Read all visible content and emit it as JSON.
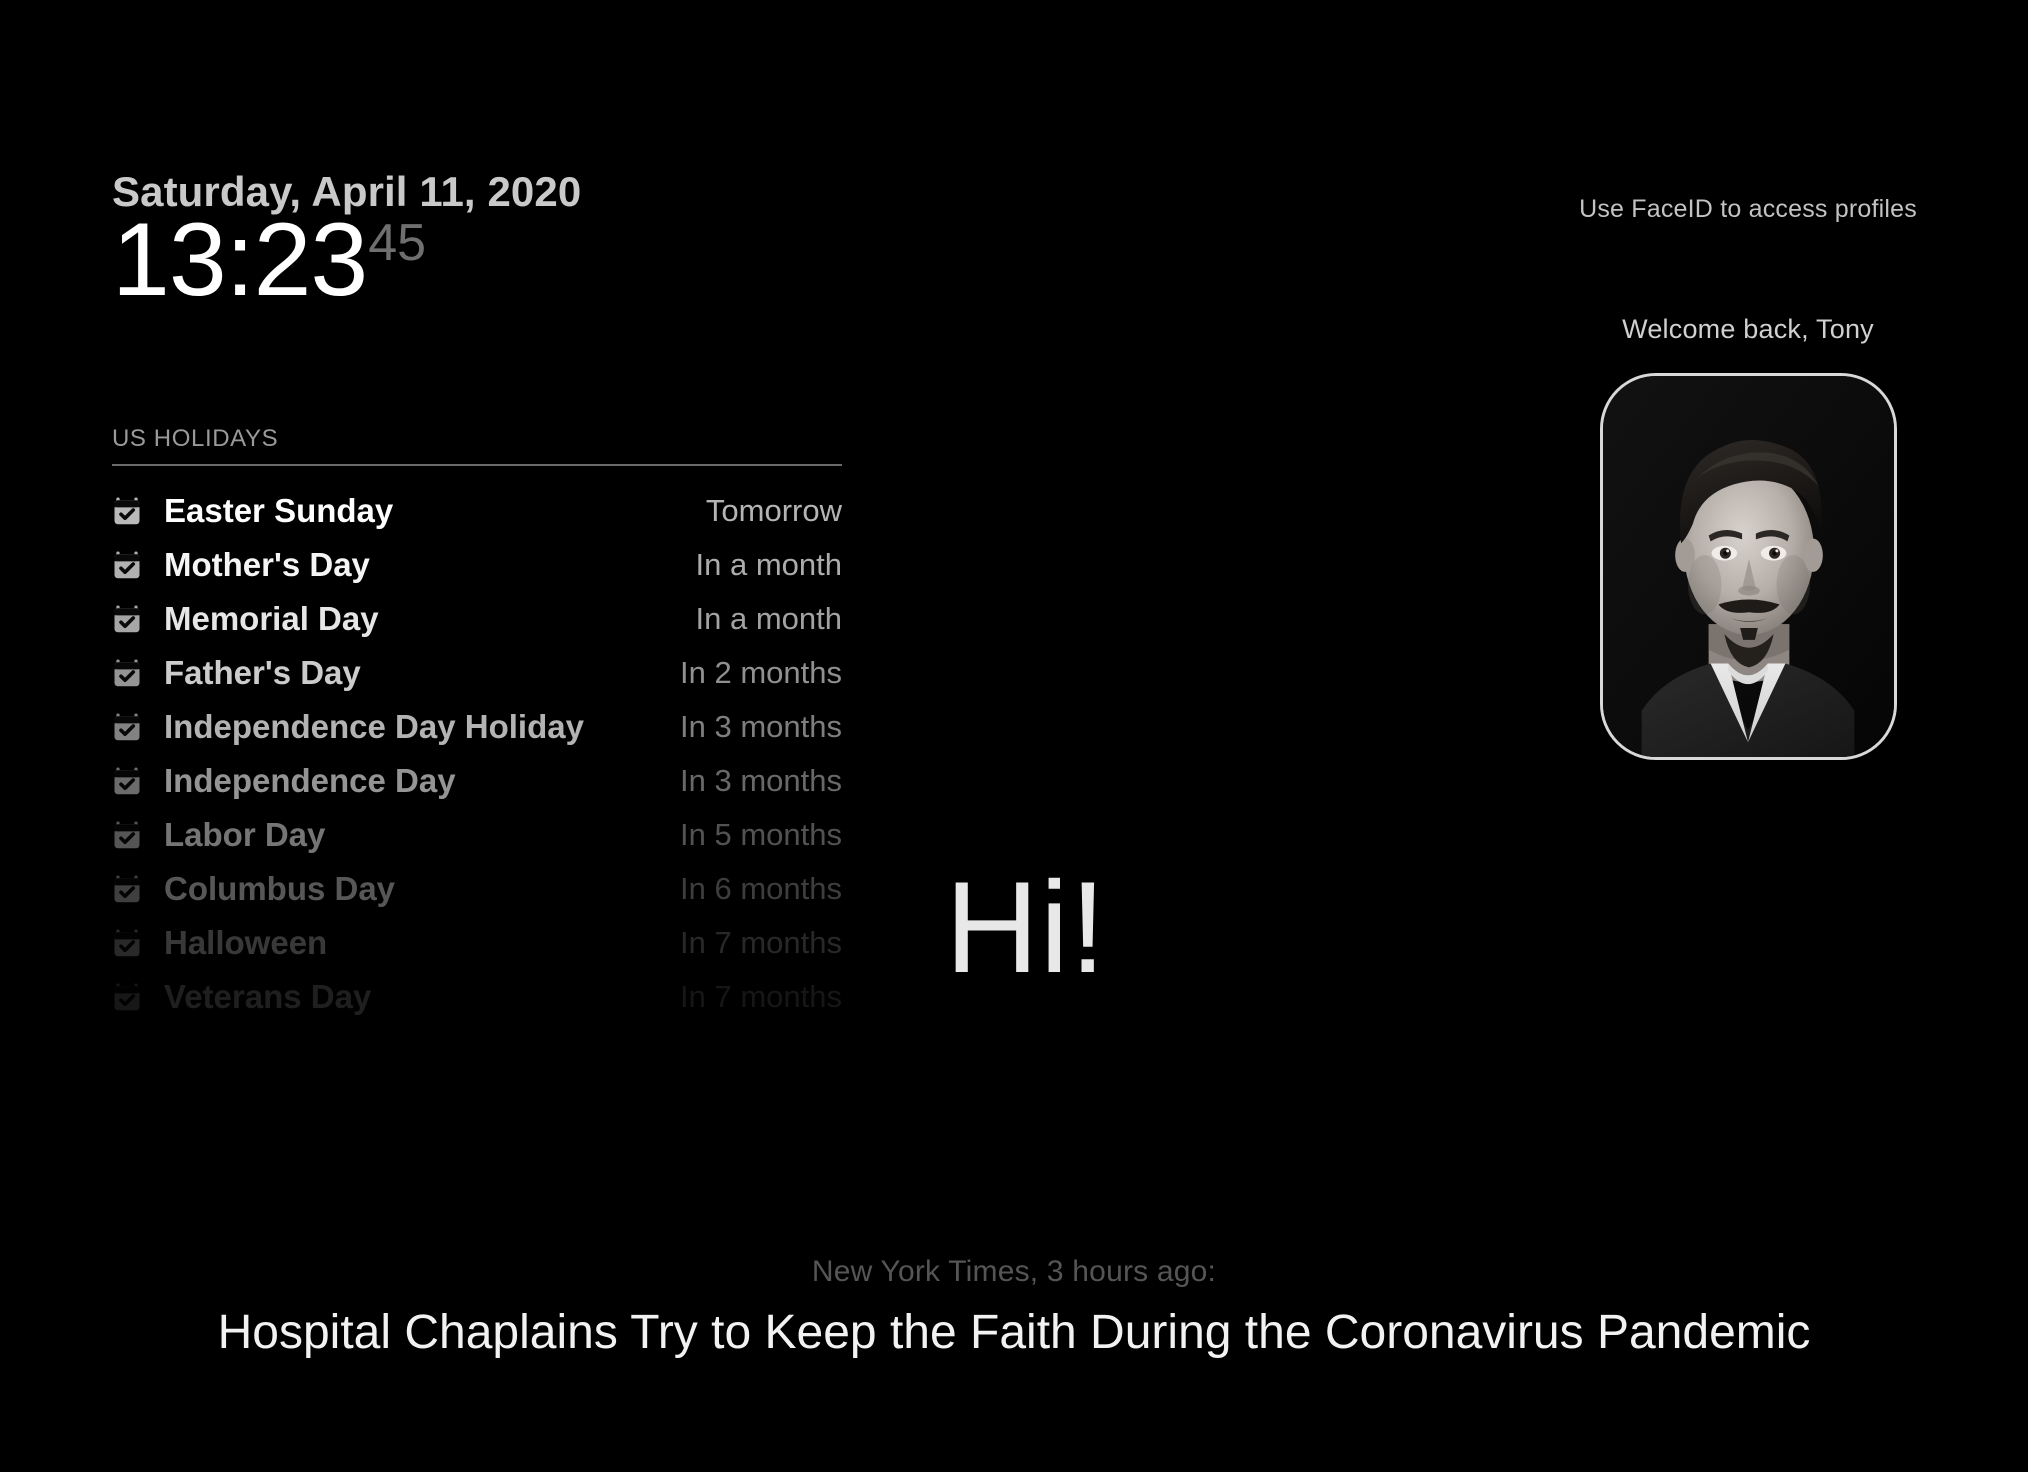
{
  "clock": {
    "date": "Saturday, April 11, 2020",
    "time": "13:23",
    "seconds": "45"
  },
  "holidays_panel": {
    "heading": "US HOLIDAYS",
    "icon": "calendar-check-icon",
    "items": [
      {
        "name": "Easter Sunday",
        "when": "Tomorrow",
        "opacity": 1.0
      },
      {
        "name": "Mother's Day",
        "when": "In a month",
        "opacity": 0.96
      },
      {
        "name": "Memorial Day",
        "when": "In a month",
        "opacity": 0.9
      },
      {
        "name": "Father's Day",
        "when": "In 2 months",
        "opacity": 0.8
      },
      {
        "name": "Independence Day Holiday",
        "when": "In 3 months",
        "opacity": 0.7
      },
      {
        "name": "Independence Day",
        "when": "In 3 months",
        "opacity": 0.58
      },
      {
        "name": "Labor Day",
        "when": "In 5 months",
        "opacity": 0.46
      },
      {
        "name": "Columbus Day",
        "when": "In 6 months",
        "opacity": 0.34
      },
      {
        "name": "Halloween",
        "when": "In 7 months",
        "opacity": 0.22
      },
      {
        "name": "Veterans Day",
        "when": "In 7 months",
        "opacity": 0.12
      }
    ]
  },
  "profile": {
    "faceid_hint": "Use FaceID to access profiles",
    "welcome": "Welcome back, Tony",
    "avatar": "user-portrait-avatar"
  },
  "greeting": {
    "text": "Hi!"
  },
  "news": {
    "source": "New York Times, 3 hours ago:",
    "headline": "Hospital Chaplains Try to Keep the Faith During the Coronavirus Pandemic"
  },
  "colors": {
    "background": "#000000",
    "primary_text": "#ffffff",
    "muted_text": "#9a9a9a",
    "dim_text": "#555555",
    "divider": "#6a6a6a",
    "avatar_border": "#d8d8d8"
  }
}
